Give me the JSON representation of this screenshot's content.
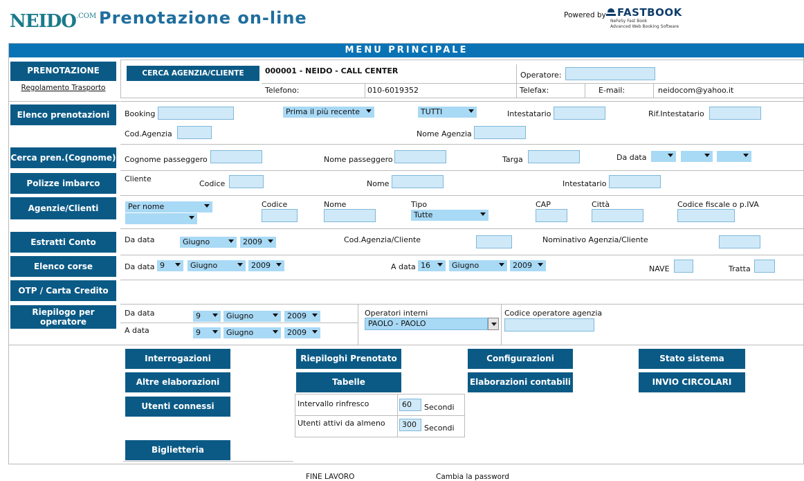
{
  "header": {
    "logo_text": "NEIDO",
    "logo_suffix": ".COM",
    "title": "Prenotazione on-line",
    "powered_by": "Powered by",
    "fastbook_title": "FASTBOOK",
    "fastbook_sub1": "NeFeSy Fast Book",
    "fastbook_sub2": "Advanced Web Booking Software"
  },
  "menu_title": "MENU PRINCIPALE",
  "nav": {
    "prenotazione": "PRENOTAZIONE",
    "regolamento": "Regolamento Trasporto",
    "elenco_prenotazioni": "Elenco prenotazioni",
    "cerca_pren": "Cerca pren.(Cognome)",
    "polizze": "Polizze imbarco",
    "agenzie": "Agenzie/Clienti",
    "estratti": "Estratti Conto",
    "elenco_corse": "Elenco corse",
    "otp": "OTP / Carta Credito",
    "riepilogo": "Riepilogo per operatore"
  },
  "agency": {
    "button": "CERCA AGENZIA/CLIENTE",
    "name": "000001 - NEIDO - CALL CENTER",
    "operatore_label": "Operatore:",
    "telefono_label": "Telefono:",
    "telefono": "010-6019352",
    "telefax_label": "Telefax:",
    "email_label": "E-mail:",
    "email": "neidocom@yahoo.it"
  },
  "elenco": {
    "booking": "Booking",
    "order": "Prima il più recente",
    "status": "TUTTI",
    "intestatario": "Intestatario",
    "rif": "Rif.Intestatario",
    "cod_agenzia": "Cod.Agenzia",
    "nome_agenzia": "Nome Agenzia"
  },
  "cerca": {
    "cognome": "Cognome passeggero",
    "nome": "Nome passeggero",
    "targa": "Targa",
    "da_data": "Da data"
  },
  "polizze": {
    "cliente": "Cliente",
    "codice": "Codice",
    "nome": "Nome",
    "intestatario": "Intestatario"
  },
  "agenzie": {
    "order": "Per nome",
    "codice": "Codice",
    "nome": "Nome",
    "tipo": "Tipo",
    "tipo_value": "Tutte",
    "cap": "CAP",
    "citta": "Città",
    "cf": "Codice fiscale o p.IVA"
  },
  "estratti": {
    "da_data": "Da data",
    "month": "Giugno",
    "year": "2009",
    "cod": "Cod.Agenzia/Cliente",
    "nominativo": "Nominativo Agenzia/Cliente"
  },
  "corse": {
    "da_data": "Da data",
    "day1": "9",
    "month1": "Giugno",
    "year1": "2009",
    "a_data": "A data",
    "day2": "16",
    "month2": "Giugno",
    "year2": "2009",
    "nave": "NAVE",
    "tratta": "Tratta"
  },
  "riepilogo": {
    "da_data": "Da data",
    "a_data": "A data",
    "day": "9",
    "month": "Giugno",
    "year": "2009",
    "operatori": "Operatori interni",
    "operatore_value": "PAOLO - PAOLO",
    "codice_op": "Codice operatore agenzia"
  },
  "actions": {
    "interrogazioni": "Interrogazioni",
    "riepiloghi": "Riepiloghi Prenotato",
    "configurazioni": "Configurazioni",
    "stato": "Stato sistema",
    "altre": "Altre elaborazioni",
    "tabelle": "Tabelle",
    "contabili": "Elaborazioni contabili",
    "circolari": "INVIO CIRCOLARI",
    "utenti": "Utenti connessi",
    "intervallo_label": "Intervallo rinfresco",
    "intervallo_value": "60",
    "attivi_label": "Utenti attivi da almeno",
    "attivi_value": "300",
    "secondi": "Secondi",
    "biglietteria": "Biglietteria"
  },
  "footer": {
    "fine": "FINE LAVORO",
    "password": "Cambia la password"
  },
  "colors": {
    "nav_bg": "#0b5a86",
    "menubar_bg": "#0a73b5",
    "input_bg": "#cfe9f8",
    "select_bg": "#a8d9f5"
  }
}
